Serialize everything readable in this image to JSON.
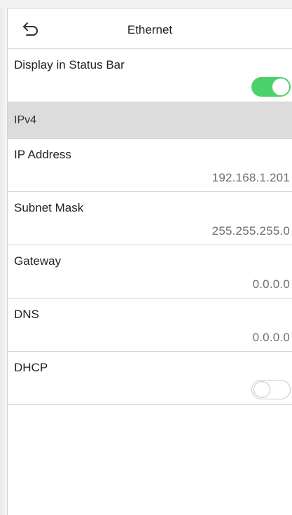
{
  "header": {
    "title": "Ethernet",
    "back_icon": "back-arrow-icon"
  },
  "display_status_bar": {
    "label": "Display in Status Bar",
    "enabled": true
  },
  "section": {
    "label": "IPv4"
  },
  "fields": [
    {
      "label": "IP Address",
      "value": "192.168.1.201"
    },
    {
      "label": "Subnet Mask",
      "value": "255.255.255.0"
    },
    {
      "label": "Gateway",
      "value": "0.0.0.0"
    },
    {
      "label": "DNS",
      "value": "0.0.0.0"
    }
  ],
  "dhcp": {
    "label": "DHCP",
    "enabled": false
  },
  "colors": {
    "toggle_on": "#4cd26c",
    "section_bg": "#dcdcdc",
    "divider": "#d6d6d6"
  }
}
